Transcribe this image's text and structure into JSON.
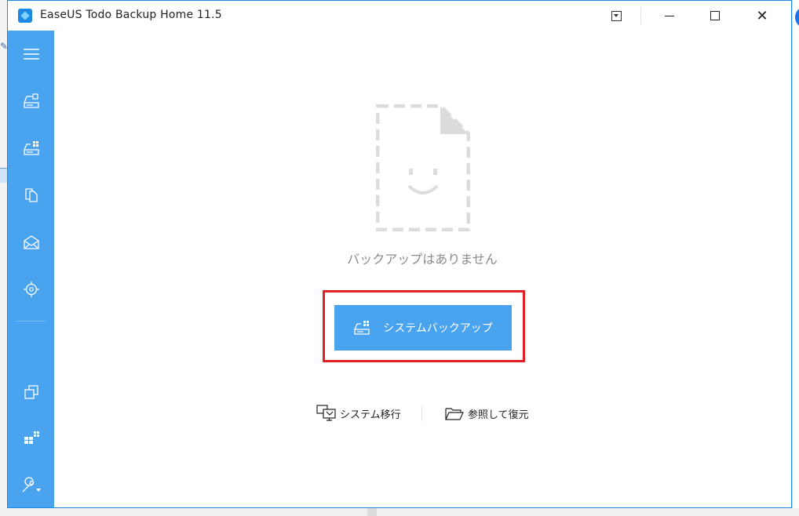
{
  "window": {
    "title": "EaseUS Todo Backup Home 11.5",
    "accent_color": "#4aa3ef"
  },
  "titlebar_buttons": [
    "dropdown-icon",
    "minimize-icon",
    "maximize-icon",
    "close-icon"
  ],
  "sidebar": {
    "items": [
      {
        "icon": "menu-icon"
      },
      {
        "icon": "disk-backup-icon"
      },
      {
        "icon": "system-backup-icon"
      },
      {
        "icon": "file-backup-icon"
      },
      {
        "icon": "mail-backup-icon"
      },
      {
        "icon": "smart-backup-icon"
      },
      {
        "icon": "clone-icon"
      },
      {
        "icon": "windows-icon"
      },
      {
        "icon": "tools-icon"
      }
    ]
  },
  "main": {
    "empty_message": "バックアップはありません",
    "primary_button": {
      "label": "システムバックアップ",
      "icon": "system-backup-icon"
    },
    "links": [
      {
        "label": "システム移行",
        "icon": "system-migrate-icon"
      },
      {
        "label": "参照して復元",
        "icon": "folder-icon"
      }
    ]
  }
}
